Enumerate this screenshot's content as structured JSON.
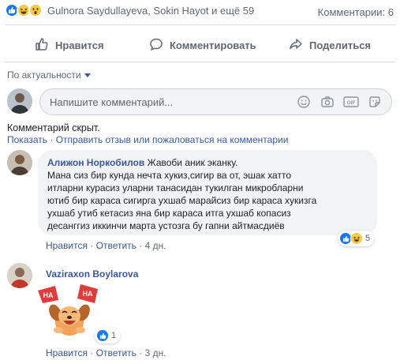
{
  "summary": {
    "names": "Gulnora Saydullayeva, Sokin Hayot и ещё 59",
    "comments_count": "Комментарии: 6",
    "reactions": [
      "like-icon",
      "haha-icon",
      "wow-icon"
    ]
  },
  "actions": {
    "like": "Нравится",
    "comment": "Комментировать",
    "share": "Поделиться"
  },
  "sort": {
    "label": "По актуальности"
  },
  "composer": {
    "placeholder": "Напишите комментарий..."
  },
  "hidden_notice": {
    "text": "Комментарий скрыт.",
    "show": "Показать",
    "separator": " · ",
    "feedback": "Отправить отзыв или пожаловаться на комментарии"
  },
  "comments": [
    {
      "author": "Алижон Норкобилов",
      "text_lines": [
        "Жавоби аник эканку.",
        "Мана сиз бир кунда нечта хукиз,сигир ва от, эшак хатто",
        "итларни курасиз уларни танасидан тукилган микробларни",
        "ютиб бир караса сигирга ухшаб марайсиз бир караса хукизга",
        "ухшаб утиб кетасиз яна бир караса итга ухшаб копасиз",
        "десанггиз иккинчи марта устозга бу гапни айтмасдиёв"
      ],
      "reaction_count": "5",
      "like": "Нравится",
      "reply": "Ответить",
      "time": "4 дн."
    },
    {
      "author": "Vaziraxon Boylarova",
      "sticker_text": "HA HA",
      "reaction_count": "1",
      "like": "Нравится",
      "reply": "Ответить",
      "time": "3 дн."
    }
  ],
  "colors": {
    "link": "#385898",
    "like_blue": "#1877f2",
    "muted": "#606770",
    "bubble": "#f2f3f5"
  }
}
